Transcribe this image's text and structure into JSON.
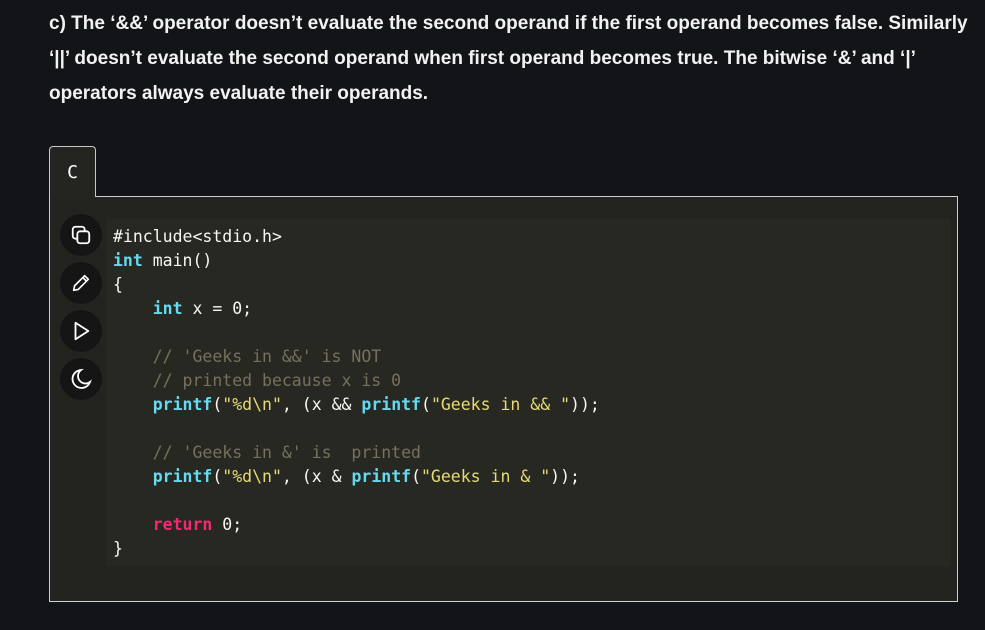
{
  "description": {
    "label": "c)",
    "text": " The ‘&&’ operator doesn’t evaluate the second operand if the first operand becomes false. Similarly ‘||’ doesn’t evaluate the second operand when first operand becomes true. The bitwise ‘&’ and ‘|’ operators always evaluate their operands."
  },
  "code_tab": {
    "label": "C"
  },
  "toolbar": [
    {
      "icon": "copy-icon"
    },
    {
      "icon": "pencil-icon"
    },
    {
      "icon": "play-icon"
    },
    {
      "icon": "moon-icon"
    }
  ],
  "code_lines": [
    [
      [
        "#include<stdio.h>",
        ""
      ]
    ],
    [
      [
        "int",
        "k"
      ],
      [
        " main()",
        ""
      ]
    ],
    [
      [
        "{",
        ""
      ]
    ],
    [
      [
        "    ",
        ""
      ],
      [
        "int",
        "k"
      ],
      [
        " x = 0;",
        ""
      ]
    ],
    [
      [
        "",
        ""
      ]
    ],
    [
      [
        "    // 'Geeks in &&' is NOT",
        "c"
      ]
    ],
    [
      [
        "    // printed because x is 0",
        "c"
      ]
    ],
    [
      [
        "    ",
        ""
      ],
      [
        "printf",
        "k"
      ],
      [
        "(",
        ""
      ],
      [
        "\"%d\\n\"",
        "s"
      ],
      [
        ", (x && ",
        ""
      ],
      [
        "printf",
        "k"
      ],
      [
        "(",
        ""
      ],
      [
        "\"Geeks in && \"",
        "s"
      ],
      [
        "));",
        ""
      ]
    ],
    [
      [
        "",
        ""
      ]
    ],
    [
      [
        "    // 'Geeks in &' is  printed",
        "c"
      ]
    ],
    [
      [
        "    ",
        ""
      ],
      [
        "printf",
        "k"
      ],
      [
        "(",
        ""
      ],
      [
        "\"%d\\n\"",
        "s"
      ],
      [
        ", (x & ",
        ""
      ],
      [
        "printf",
        "k"
      ],
      [
        "(",
        ""
      ],
      [
        "\"Geeks in & \"",
        "s"
      ],
      [
        "));",
        ""
      ]
    ],
    [
      [
        "",
        ""
      ]
    ],
    [
      [
        "    ",
        ""
      ],
      [
        "return",
        "r"
      ],
      [
        " 0;",
        ""
      ]
    ],
    [
      [
        "}",
        ""
      ]
    ]
  ]
}
